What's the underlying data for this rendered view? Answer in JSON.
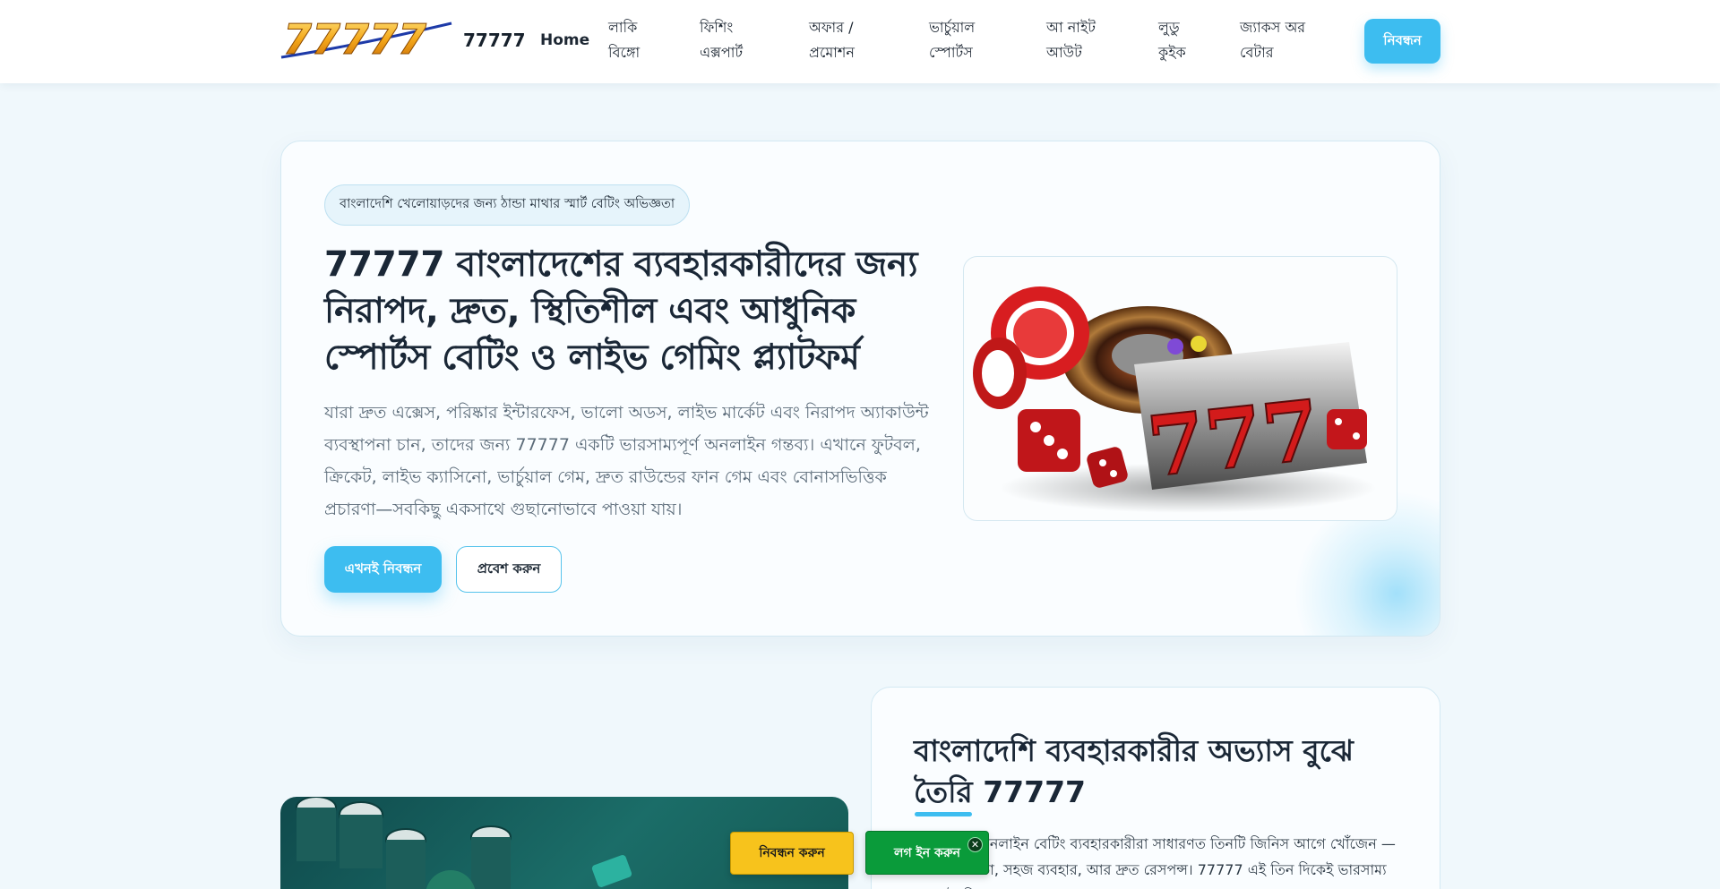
{
  "brand": {
    "logo_text": "77777",
    "name": "77777"
  },
  "nav": {
    "home": "Home",
    "items": [
      {
        "line1": "লাকি",
        "line2": "বিঙ্গো"
      },
      {
        "line1": "ফিশিং",
        "line2": "এক্সপার্ট"
      },
      {
        "line1": "অফার /",
        "line2": "প্রমোশন"
      },
      {
        "line1": "ভার্চুয়াল",
        "line2": "স্পোর্টস"
      },
      {
        "line1": "আ নাইট",
        "line2": "আউট"
      },
      {
        "line1": "লুডু",
        "line2": "কুইক"
      },
      {
        "line1": "জ্যাকস অর",
        "line2": "বেটার"
      }
    ],
    "register": "নিবন্ধন"
  },
  "hero": {
    "pill": "বাংলাদেশি খেলোয়াড়দের জন্য ঠান্ডা মাথার স্মার্ট বেটিং অভিজ্ঞতা",
    "title": "77777 বাংলাদেশের ব্যবহারকারীদের জন্য নিরাপদ, দ্রুত, স্থিতিশীল এবং আধুনিক স্পোর্টস বেটিং ও লাইভ গেমিং প্ল্যাটফর্ম",
    "description": "যারা দ্রুত এক্সেস, পরিষ্কার ইন্টারফেস, ভালো অডস, লাইভ মার্কেট এবং নিরাপদ অ্যাকাউন্ট ব্যবস্থাপনা চান, তাদের জন্য 77777 একটি ভারসাম্যপূর্ণ অনলাইন গন্তব্য। এখানে ফুটবল, ক্রিকেট, লাইভ ক্যাসিনো, ভার্চুয়াল গেম, দ্রুত রাউন্ডের ফান গেম এবং বোনাসভিত্তিক প্রচারণা—সবকিছু একসাথে গুছানোভাবে পাওয়া যায়।",
    "cta_primary": "এখনই নিবন্ধন",
    "cta_secondary": "প্রবেশ করুন",
    "image_digits": "777"
  },
  "info": {
    "title": "বাংলাদেশি ব্যবহারকারীর অভ্যাস বুঝে তৈরি 77777",
    "text": "বাংলাদেশি অনলাইন বেটিং ব্যবহারকারীরা সাধারণত তিনটি জিনিস আগে খোঁজেন — বিশ্বাসযোগ্যতা, সহজ ব্যবহার, আর দ্রুত রেসপন্স। 77777 এই তিন দিকেই ভারসাম্য রেখে তৈরি।"
  },
  "floating": {
    "register": "নিবন্ধন করুন",
    "login": "লগ ইন করুন",
    "close": "✕"
  },
  "colors": {
    "accent": "#3dbdf0",
    "register_yellow": "#f7c31c",
    "login_green": "#0a9b3a"
  }
}
